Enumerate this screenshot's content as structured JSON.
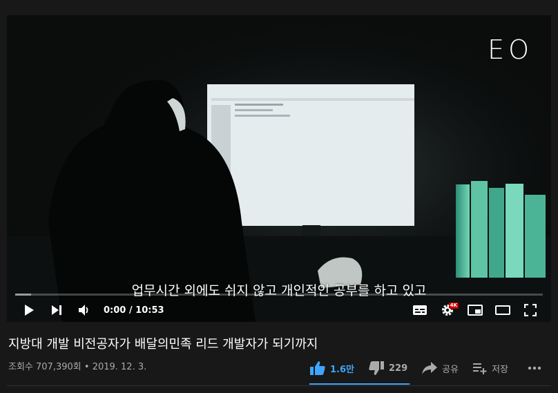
{
  "player": {
    "logo_text": "EO",
    "subtitle": "업무시간 외에도 쉬지 않고 개인적인 공부를 하고 있고",
    "time_current": "0:00",
    "time_total": "10:53",
    "progress": 0.0,
    "buffered": 0.03,
    "quality_badge": "4K"
  },
  "video": {
    "title": "지방대 개발 비전공자가 배달의민족 리드 개발자가 되기까지",
    "views": "조회수 707,390회",
    "separator": "•",
    "date": "2019. 12. 3."
  },
  "actions": {
    "like_count": "1.6만",
    "dislike_count": "229",
    "share_label": "공유",
    "save_label": "저장",
    "like_ratio": 0.985
  },
  "colors": {
    "accent": "#3ea6ff",
    "background": "#181818",
    "progress": "#ff0000"
  }
}
